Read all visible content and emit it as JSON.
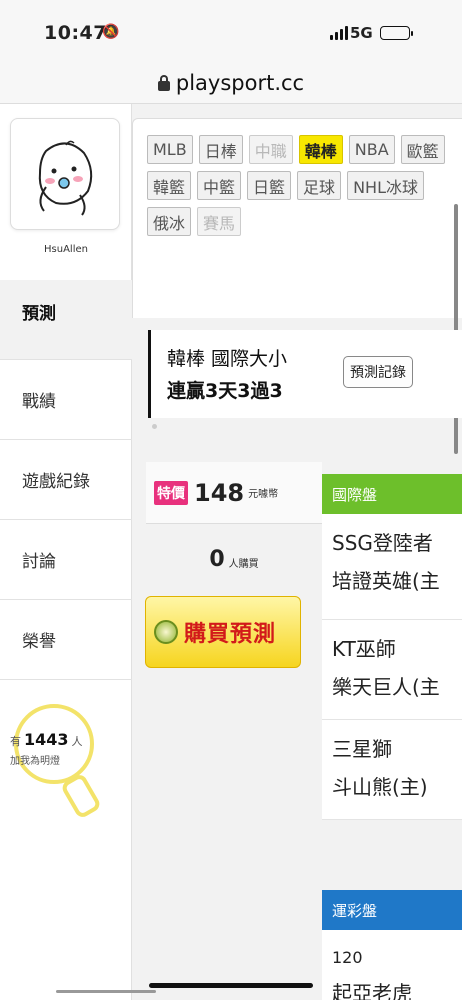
{
  "status_bar": {
    "time": "10:47",
    "network": "5G"
  },
  "browser": {
    "url": "playsport.cc"
  },
  "sidebar": {
    "username": "HsuAllen",
    "nav": [
      {
        "label": "預測",
        "active": true
      },
      {
        "label": "戰績",
        "active": false
      },
      {
        "label": "遊戲紀錄",
        "active": false
      },
      {
        "label": "討論",
        "active": false
      },
      {
        "label": "榮譽",
        "active": false
      }
    ],
    "fans": {
      "prefix": "有",
      "count": "1443",
      "suffix": "人",
      "caption": "加我為明燈"
    }
  },
  "tags": [
    {
      "label": "MLB",
      "state": "normal"
    },
    {
      "label": "日棒",
      "state": "normal"
    },
    {
      "label": "中職",
      "state": "disabled"
    },
    {
      "label": "韓棒",
      "state": "selected"
    },
    {
      "label": "NBA",
      "state": "normal"
    },
    {
      "label": "歐籃",
      "state": "normal"
    },
    {
      "label": "韓籃",
      "state": "normal"
    },
    {
      "label": "中籃",
      "state": "normal"
    },
    {
      "label": "日籃",
      "state": "normal"
    },
    {
      "label": "足球",
      "state": "normal"
    },
    {
      "label": "NHL冰球",
      "state": "normal"
    },
    {
      "label": "俄冰",
      "state": "normal"
    },
    {
      "label": "賽馬",
      "state": "disabled"
    }
  ],
  "prediction": {
    "title": "韓棒 國際大小",
    "streak": "連贏3天3過3",
    "record_button": "預測記錄"
  },
  "purchase": {
    "special_label": "特價",
    "price": "148",
    "currency": "元噱幣",
    "buyers": "0",
    "buyers_label": "人購買",
    "buy_button": "購買預測"
  },
  "intl_board": {
    "header": "國際盤",
    "matches": [
      {
        "team1": "SSG登陸者",
        "team2": "培證英雄(主"
      },
      {
        "team1": "KT巫師",
        "team2": "樂天巨人(主"
      },
      {
        "team1": "三星獅",
        "team2": "斗山熊(主)"
      }
    ]
  },
  "lottery_board": {
    "header": "運彩盤",
    "number": "120",
    "team": "起亞老虎"
  }
}
